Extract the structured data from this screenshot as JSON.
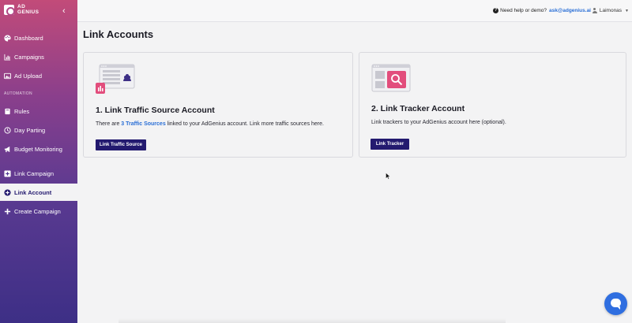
{
  "brand": {
    "line1": "AD",
    "line2": "GENIUS",
    "logo_icon": "adgenius-logo-icon"
  },
  "sidebar": {
    "collapse_icon": "chevron-left-icon",
    "items": [
      {
        "label": "Dashboard",
        "icon": "palette-icon"
      },
      {
        "label": "Campaigns",
        "icon": "bar-chart-icon"
      },
      {
        "label": "Ad Upload",
        "icon": "image-icon"
      }
    ],
    "section_label": "AUTOMATION",
    "automation_items": [
      {
        "label": "Rules",
        "icon": "book-icon"
      },
      {
        "label": "Day Parting",
        "icon": "clock-icon"
      },
      {
        "label": "Budget Monitoring",
        "icon": "megaphone-icon"
      }
    ],
    "bottom_items": [
      {
        "label": "Link Campaign",
        "icon": "plus-square-icon"
      },
      {
        "label": "Link Account",
        "icon": "plus-circle-icon",
        "active": true
      },
      {
        "label": "Create Campaign",
        "icon": "plus-icon"
      }
    ]
  },
  "topbar": {
    "help_text": "Need help or demo?",
    "help_email": "ask@adgenius.ai",
    "user_name": "Laimonas"
  },
  "page": {
    "title": "Link Accounts"
  },
  "cards": {
    "traffic": {
      "title": "1. Link Traffic Source Account",
      "desc_prefix": "There are ",
      "desc_link": "3 Traffic Sources",
      "desc_suffix": " linked to your AdGenius account. Link more traffic sources here.",
      "button": "Link Traffic Source"
    },
    "tracker": {
      "title": "2. Link Tracker Account",
      "desc": "Link trackers to your AdGenius account here (optional).",
      "button": "Link Tracker"
    }
  },
  "colors": {
    "accent": "#231a6f",
    "link": "#2a6fd6",
    "illustration_pink": "#e24d7c",
    "chat": "#2f6ee0"
  }
}
